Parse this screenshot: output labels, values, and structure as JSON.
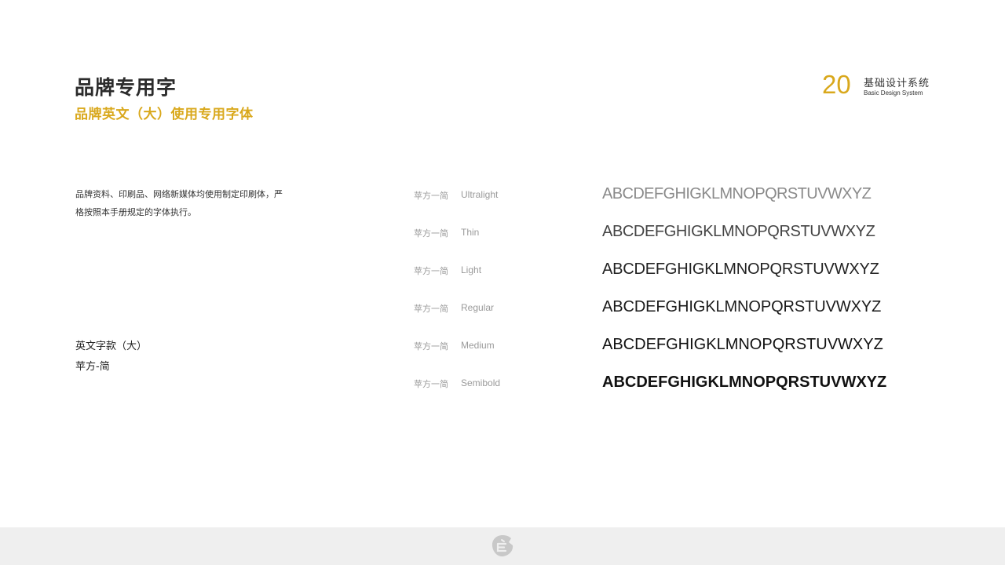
{
  "header": {
    "title": "品牌专用字",
    "subtitle": "品牌英文（大）使用专用字体",
    "page_number": "20",
    "system_cn": "基础设计系统",
    "system_en": "Basic Design System"
  },
  "description": {
    "line1": "品牌资料、印刷品、网络新媒体均使用制定印刷体，严",
    "line2": "格按照本手册规定的字体执行。"
  },
  "font_info": {
    "name": "英文字款（大）",
    "family": "苹方-简"
  },
  "weights": [
    {
      "family": "苹方一简",
      "weight": "Ultralight",
      "sample": "ABCDEFGHIGKLMNOPQRSTUVWXYZ"
    },
    {
      "family": "苹方一简",
      "weight": "Thin",
      "sample": "ABCDEFGHIGKLMNOPQRSTUVWXYZ"
    },
    {
      "family": "苹方一简",
      "weight": "Light",
      "sample": "ABCDEFGHIGKLMNOPQRSTUVWXYZ"
    },
    {
      "family": "苹方一简",
      "weight": "Regular",
      "sample": "ABCDEFGHIGKLMNOPQRSTUVWXYZ"
    },
    {
      "family": "苹方一简",
      "weight": "Medium",
      "sample": "ABCDEFGHIGKLMNOPQRSTUVWXYZ"
    },
    {
      "family": "苹方一简",
      "weight": "Semibold",
      "sample": "ABCDEFGHIGKLMNOPQRSTUVWXYZ"
    }
  ],
  "colors": {
    "accent": "#d9a81c",
    "footer_bg": "#efefef",
    "footer_logo": "#c8c8c8"
  },
  "footer": {
    "logo_icon": "brand-logo-icon"
  }
}
